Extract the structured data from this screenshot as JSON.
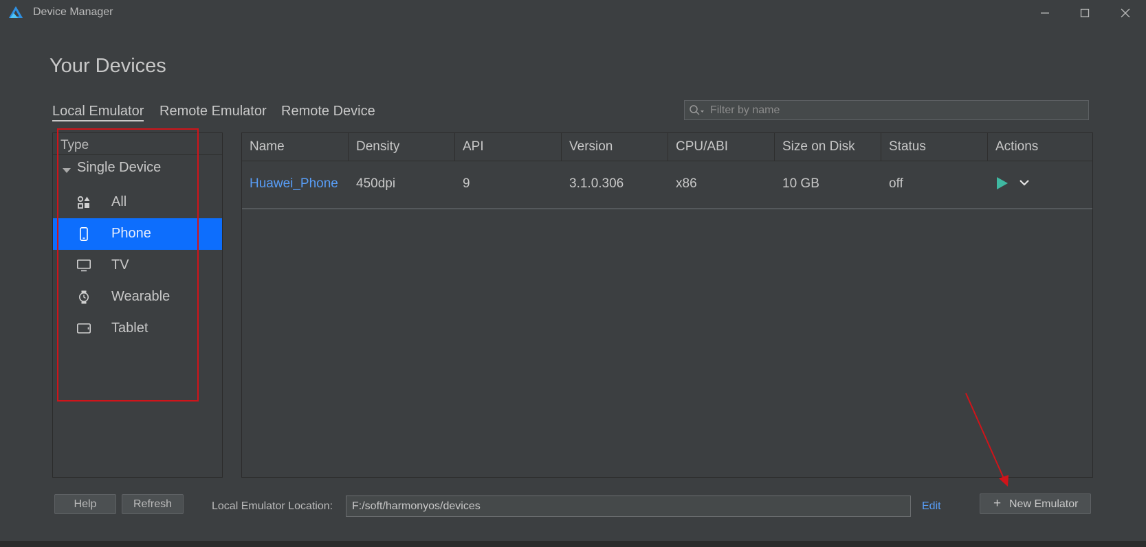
{
  "window": {
    "title": "Device Manager",
    "accent_color": "#0d6efd",
    "link_color": "#589df6"
  },
  "page": {
    "heading": "Your Devices"
  },
  "tabs": [
    {
      "label": "Local Emulator",
      "active": true
    },
    {
      "label": "Remote Emulator",
      "active": false
    },
    {
      "label": "Remote Device",
      "active": false
    }
  ],
  "search": {
    "placeholder": "Filter by name",
    "value": ""
  },
  "sidebar": {
    "header": "Type",
    "group": "Single Device",
    "items": [
      {
        "label": "All",
        "icon": "grid-shapes-icon",
        "selected": false
      },
      {
        "label": "Phone",
        "icon": "phone-icon",
        "selected": true
      },
      {
        "label": "TV",
        "icon": "tv-icon",
        "selected": false
      },
      {
        "label": "Wearable",
        "icon": "watch-icon",
        "selected": false
      },
      {
        "label": "Tablet",
        "icon": "tablet-icon",
        "selected": false
      }
    ]
  },
  "table": {
    "columns": [
      "Name",
      "Density",
      "API",
      "Version",
      "CPU/ABI",
      "Size on Disk",
      "Status",
      "Actions"
    ],
    "rows": [
      {
        "name": "Huawei_Phone",
        "density": "450dpi",
        "api": "9",
        "version": "3.1.0.306",
        "cpu_abi": "x86",
        "size_on_disk": "10 GB",
        "status": "off"
      }
    ]
  },
  "footer": {
    "help_label": "Help",
    "refresh_label": "Refresh",
    "location_label": "Local Emulator Location:",
    "location_value": "F:/soft/harmonyos/devices",
    "edit_label": "Edit",
    "new_emulator_label": "New Emulator"
  },
  "annotations": {
    "color": "#d0141a"
  }
}
